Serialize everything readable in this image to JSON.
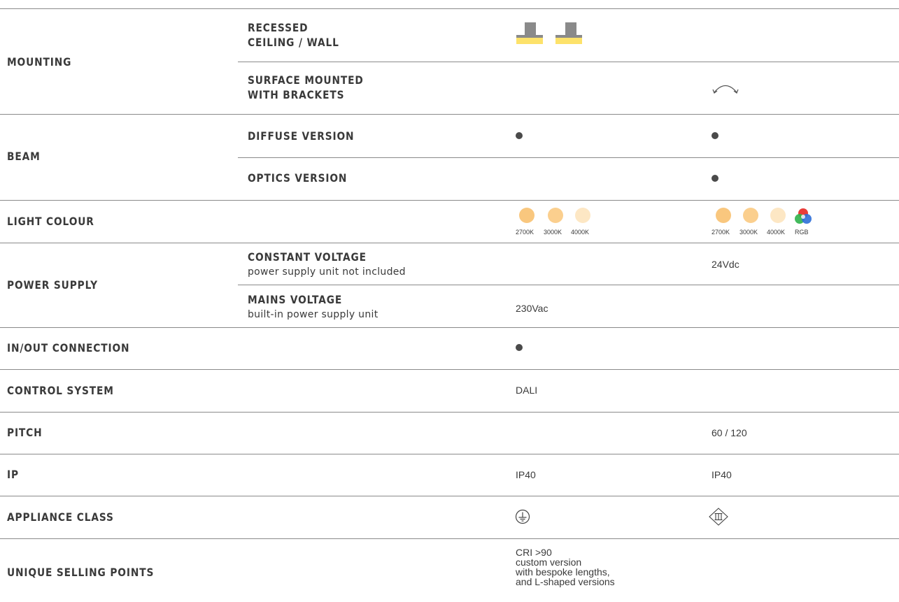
{
  "rows": {
    "mounting": {
      "label": "MOUNTING",
      "recessed": {
        "line1": "RECESSED",
        "line2": "CEILING / WALL",
        "icon": "recessed-mount-icon"
      },
      "surface": {
        "line1": "SURFACE MOUNTED",
        "line2": "WITH BRACKETS",
        "icon": "bracket-rotate-icon"
      }
    },
    "beam": {
      "label": "BEAM",
      "diffuse": {
        "label": "DIFFUSE VERSION"
      },
      "optics": {
        "label": "OPTICS VERSION"
      }
    },
    "light_colour": {
      "label": "LIGHT COLOUR",
      "col1": [
        "2700K",
        "3000K",
        "4000K"
      ],
      "col2": [
        "2700K",
        "3000K",
        "4000K",
        "RGB"
      ],
      "colors": {
        "2700K": "#f9c77e",
        "3000K": "#fbcf8e",
        "4000K": "#fde7c4"
      }
    },
    "power_supply": {
      "label": "POWER SUPPLY",
      "constant": {
        "title": "CONSTANT VOLTAGE",
        "note": "power supply unit not included",
        "value": "24Vdc"
      },
      "mains": {
        "title": "MAINS VOLTAGE",
        "note": "built-in power supply unit",
        "value": "230Vac"
      }
    },
    "inout": {
      "label": "IN/OUT CONNECTION"
    },
    "control": {
      "label": "CONTROL SYSTEM",
      "value": "DALI"
    },
    "pitch": {
      "label": "PITCH",
      "value": "60 / 120"
    },
    "ip": {
      "label": "IP",
      "col1": "IP40",
      "col2": "IP40"
    },
    "appliance": {
      "label": "APPLIANCE CLASS",
      "col1_icon": "class-i-earth-icon",
      "col2_icon": "class-iii-icon"
    },
    "usp": {
      "label": "UNIQUE SELLING POINTS",
      "lines": [
        "CRI >90",
        "custom version",
        "with bespoke lengths,",
        "and L-shaped versions"
      ]
    }
  },
  "colors": {
    "text": "#3a3a3a",
    "rule": "#8a8a8a",
    "led_yellow": "#fde26a",
    "housing_grey": "#8a8a8a"
  }
}
